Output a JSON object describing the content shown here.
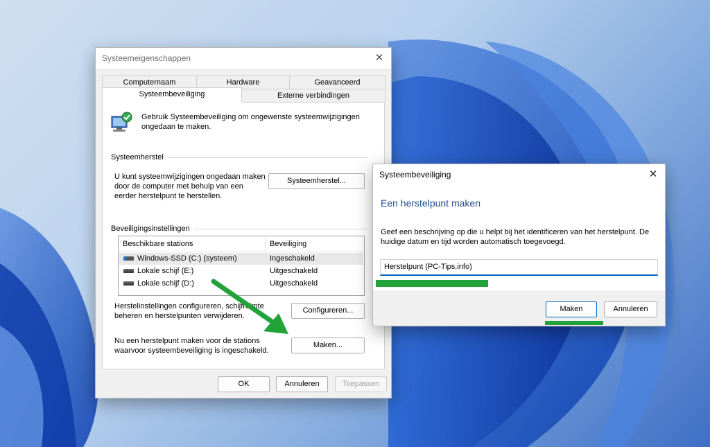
{
  "colors": {
    "accent": "#0067c0",
    "highlight_green": "#21a33a",
    "heading_blue": "#1f4e8c"
  },
  "main_dialog": {
    "title": "Systeemeigenschappen",
    "tabs_row1": [
      "Computernaam",
      "Hardware",
      "Geavanceerd"
    ],
    "tabs_row2": [
      "Systeembeveiliging",
      "Externe verbindingen"
    ],
    "intro": [
      "Gebruik Systeembeveiliging om ongewenste systeemwijzigingen",
      "ongedaan te maken."
    ],
    "restore_group": {
      "label": "Systeemherstel",
      "text": [
        "U kunt systeemwijzigingen ongedaan maken",
        "door de computer met behulp van een",
        "eerder herstelpunt te herstellen."
      ],
      "button": "Systeemherstel..."
    },
    "protection_group": {
      "label": "Beveiligingsinstellingen",
      "columns": [
        "Beschikbare stations",
        "Beveiliging"
      ],
      "rows": [
        {
          "station": "Windows-SSD (C:) (systeem)",
          "status": "Ingeschakeld"
        },
        {
          "station": "Lokale schijf (E:)",
          "status": "Uitgeschakeld"
        },
        {
          "station": "Lokale schijf (D:)",
          "status": "Uitgeschakeld"
        }
      ],
      "configure_text": [
        "Herstelinstellingen configureren, schijfruimte",
        "beheren en herstelpunten verwijderen."
      ],
      "configure_button": "Configureren...",
      "create_text": [
        "Nu een herstelpunt maken voor de stations",
        "waarvoor systeembeveiliging is ingeschakeld."
      ],
      "create_button": "Maken..."
    },
    "footer": {
      "ok": "OK",
      "cancel": "Annuleren",
      "apply": "Toepassen"
    }
  },
  "sub_dialog": {
    "title": "Systeembeveiliging",
    "heading": "Een herstelpunt maken",
    "description": [
      "Geef een beschrijving op die u helpt bij het identificeren van het herstelpunt. De",
      "huidige datum en tijd worden automatisch toegevoegd."
    ],
    "input_value": "Herstelpunt (PC-Tips.info)",
    "create_button": "Maken",
    "cancel_button": "Annuleren"
  }
}
